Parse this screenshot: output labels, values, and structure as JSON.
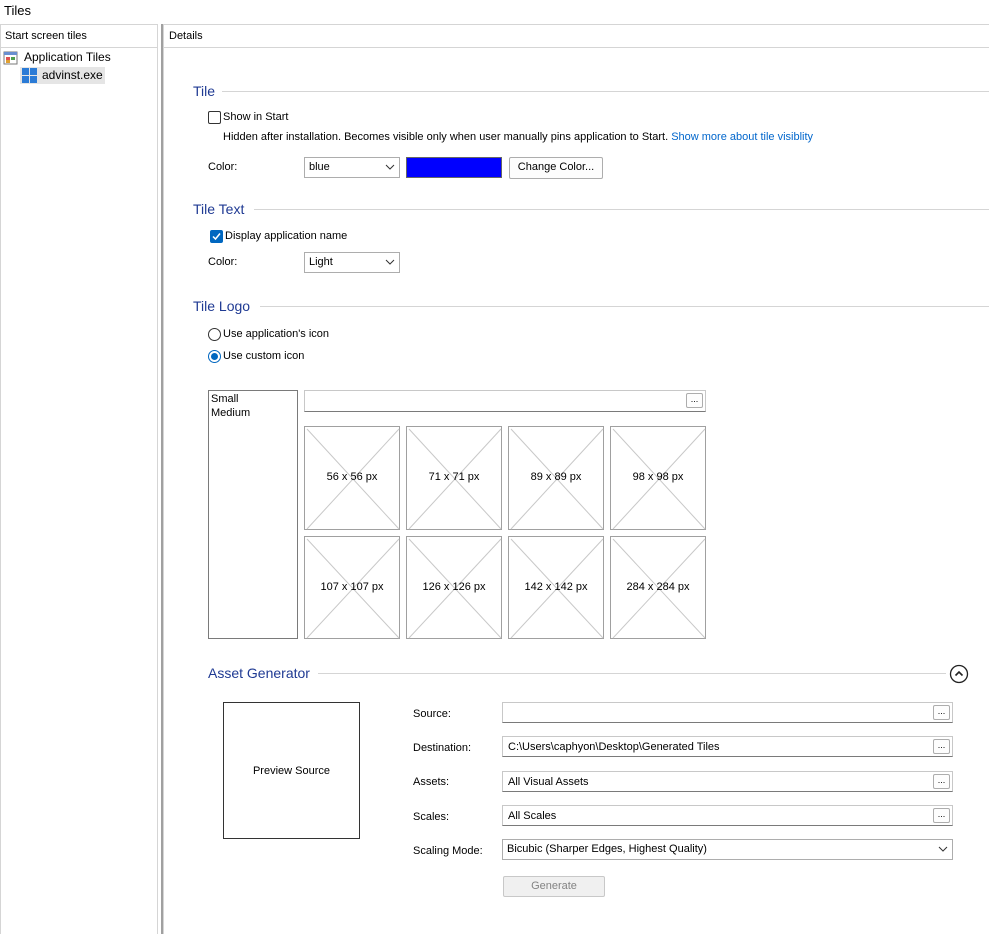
{
  "window": {
    "title": "Tiles"
  },
  "left_pane": {
    "header": "Start screen tiles",
    "tree": [
      {
        "label": "Application Tiles",
        "icon": "application-tiles-icon"
      },
      {
        "label": "advinst.exe",
        "icon": "windows-logo-icon",
        "selected": true
      }
    ]
  },
  "details": {
    "header": "Details",
    "tile": {
      "title": "Tile",
      "show_in_start_label": "Show in Start",
      "show_in_start_checked": false,
      "hint": "Hidden after installation. Becomes visible only when user manually pins application to Start.",
      "hint_link": "Show more about tile visiblity",
      "color_label": "Color:",
      "color_value": "blue",
      "swatch_color": "#0000ff",
      "change_color_button": "Change Color..."
    },
    "tile_text": {
      "title": "Tile Text",
      "display_name_label": "Display application name",
      "display_name_checked": true,
      "color_label": "Color:",
      "color_value": "Light"
    },
    "tile_logo": {
      "title": "Tile Logo",
      "use_app_icon_label": "Use application's icon",
      "use_custom_icon_label": "Use custom icon",
      "selected_option": "custom",
      "sizes_list": [
        "Small",
        "Medium"
      ],
      "path_value": "",
      "browse_label": "...",
      "tiles": [
        "56 x 56 px",
        "71 x 71 px",
        "89 x 89 px",
        "98 x 98 px",
        "107 x 107 px",
        "126 x 126 px",
        "142 x 142 px",
        "284 x 284 px"
      ]
    },
    "asset_generator": {
      "title": "Asset Generator",
      "preview_label": "Preview Source",
      "source_label": "Source:",
      "source_value": "",
      "destination_label": "Destination:",
      "destination_value": "C:\\Users\\caphyon\\Desktop\\Generated Tiles",
      "assets_label": "Assets:",
      "assets_value": "All Visual Assets",
      "scales_label": "Scales:",
      "scales_value": "All Scales",
      "scaling_mode_label": "Scaling Mode:",
      "scaling_mode_value": "Bicubic (Sharper Edges, Highest Quality)",
      "browse_label": "...",
      "generate_button": "Generate"
    }
  },
  "colors": {
    "accent": "#0067c0",
    "section_title": "#1f3a93",
    "link": "#0066cc"
  }
}
